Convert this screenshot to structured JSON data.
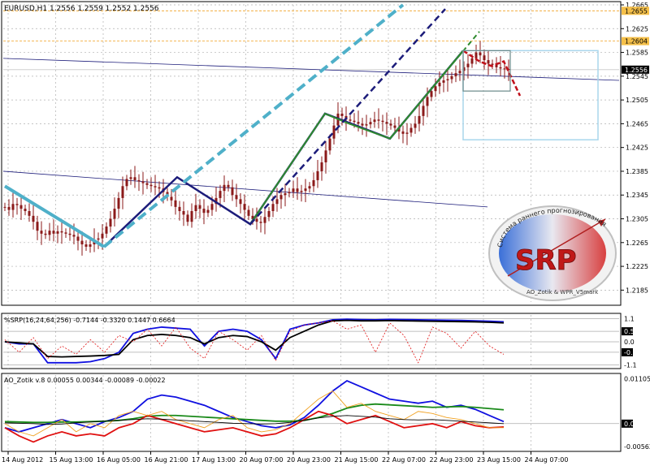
{
  "header": {
    "symbol_line": "EURUSD,H1  1.2556 1.2559 1.2552 1.2556",
    "srp_line": "%SRP(16,24,64,256) -0.7144 -0.3320 0.1447 0.6664",
    "ao_line": "AO_Zotik v.8 0.00055 0.00344 -0.00089 -0.00022"
  },
  "logo": {
    "letters": "SRP",
    "arc_text": "Система раннего прогнозирования",
    "bottom_text": "AO_Zotik & WPR_V5mark"
  },
  "colors": {
    "background": "#ffffff",
    "candles": "#8b1a1a",
    "light_blue_line": "#4fb0c9",
    "navy_line": "#1c1c7a",
    "green_line": "#2e8b2e",
    "red_dashed": "#c0101a",
    "box_light": "#a9d6ec",
    "box_gray": "#6a8a8a",
    "orange_level": "#f0a020",
    "srp_blue": "#1010e0",
    "srp_black": "#000000",
    "ao_blue": "#1010e0",
    "ao_green": "#1a8a1a",
    "ao_red": "#e01010",
    "ao_orange": "#f0a020"
  },
  "chart_data": [
    {
      "type": "candlestick",
      "title": "EURUSD,H1",
      "ylim": [
        1.2165,
        1.2665
      ],
      "y_ticks": [
        "1.2665",
        "1.2625",
        "1.2585",
        "1.2545",
        "1.2505",
        "1.2465",
        "1.2425",
        "1.2385",
        "1.2345",
        "1.2305",
        "1.2265",
        "1.2225",
        "1.2185"
      ],
      "price_tags": [
        {
          "value": "1.2655",
          "color": "#f0a020"
        },
        {
          "value": "1.2604",
          "color": "#f0a020"
        },
        {
          "value": "1.2556",
          "color": "#000000"
        }
      ],
      "x_ticks": [
        "14 Aug 2012",
        "15 Aug 13:00",
        "16 Aug 05:00",
        "16 Aug 21:00",
        "17 Aug 13:00",
        "20 Aug 07:00",
        "20 Aug 23:00",
        "21 Aug 15:00",
        "22 Aug 07:00",
        "22 Aug 23:00",
        "23 Aug 15:00",
        "24 Aug 07:00"
      ],
      "closes": [
        1.2325,
        1.232,
        1.233,
        1.2328,
        1.2322,
        1.2318,
        1.231,
        1.23,
        1.2285,
        1.228,
        1.2278,
        1.2285,
        1.228,
        1.2284,
        1.2282,
        1.228,
        1.2278,
        1.2275,
        1.2268,
        1.2262,
        1.2258,
        1.2262,
        1.227,
        1.2272,
        1.228,
        1.2292,
        1.2305,
        1.2322,
        1.234,
        1.236,
        1.2372,
        1.2375,
        1.237,
        1.2368,
        1.2365,
        1.2362,
        1.236,
        1.2358,
        1.2356,
        1.235,
        1.2342,
        1.2336,
        1.2325,
        1.2318,
        1.2312,
        1.23,
        1.2318,
        1.2328,
        1.2322,
        1.2315,
        1.232,
        1.233,
        1.234,
        1.2352,
        1.2362,
        1.2358,
        1.2345,
        1.2338,
        1.233,
        1.232,
        1.231,
        1.2305,
        1.23,
        1.2298,
        1.2308,
        1.2318,
        1.233,
        1.2338,
        1.2345,
        1.2348,
        1.235,
        1.2356,
        1.235,
        1.2352,
        1.2356,
        1.236,
        1.237,
        1.2385,
        1.24,
        1.242,
        1.244,
        1.2462,
        1.2482,
        1.2478,
        1.2472,
        1.247,
        1.2468,
        1.2465,
        1.2462,
        1.2464,
        1.2468,
        1.2472,
        1.247,
        1.2468,
        1.2465,
        1.2462,
        1.2458,
        1.2452,
        1.2448,
        1.245,
        1.2458,
        1.2465,
        1.2478,
        1.2495,
        1.251,
        1.252,
        1.2528,
        1.2534,
        1.2538,
        1.254,
        1.2545,
        1.255,
        1.2554,
        1.256,
        1.2566,
        1.2575,
        1.2585,
        1.258,
        1.2572,
        1.2566,
        1.2564,
        1.256,
        1.2558,
        1.2557,
        1.2556
      ],
      "mirrored_note": ""
    },
    {
      "type": "line",
      "title": "%SRP(16,24,64,256)",
      "ylim": [
        -1.2,
        1.2
      ],
      "y_ticks": [
        "1.1",
        "0.5",
        "0.0",
        "-0.5",
        "-1.1"
      ],
      "series": [
        {
          "color": "#1010e0",
          "values": [
            0.0,
            -0.1,
            -0.1,
            -1.0,
            -1.0,
            -1.0,
            -0.95,
            -0.8,
            -0.5,
            0.4,
            0.6,
            0.7,
            0.65,
            0.6,
            -0.2,
            0.5,
            0.6,
            0.5,
            0.1,
            -0.8,
            0.6,
            0.8,
            0.9,
            1.05,
            1.08,
            1.06,
            1.05,
            1.07,
            1.06,
            1.05,
            1.04,
            1.03,
            1.02,
            1.0,
            0.98,
            0.95
          ]
        },
        {
          "color": "#000000",
          "values": [
            0.0,
            -0.05,
            -0.1,
            -0.7,
            -0.72,
            -0.7,
            -0.68,
            -0.65,
            -0.6,
            0.1,
            0.3,
            0.35,
            0.3,
            0.2,
            -0.1,
            0.2,
            0.3,
            0.25,
            0.0,
            -0.4,
            0.2,
            0.5,
            0.8,
            1.0,
            1.02,
            1.0,
            1.0,
            1.01,
            1.0,
            0.99,
            0.98,
            0.97,
            0.96,
            0.95,
            0.93,
            0.9
          ]
        },
        {
          "color": "#e01010",
          "dashed": true,
          "values": [
            0.1,
            -0.5,
            0.2,
            -0.8,
            -0.2,
            -0.6,
            0.1,
            -0.5,
            0.3,
            0.0,
            0.6,
            -0.2,
            0.7,
            -0.3,
            -0.8,
            0.5,
            0.1,
            -0.4,
            0.3,
            -0.9,
            0.5,
            0.8,
            0.9,
            1.0,
            0.6,
            0.8,
            -0.5,
            0.9,
            0.3,
            -1.0,
            0.7,
            0.4,
            -0.3,
            0.5,
            -0.2,
            -0.6
          ]
        }
      ]
    },
    {
      "type": "line",
      "title": "AO_Zotik v.8",
      "ylim": [
        -0.006,
        0.0115
      ],
      "y_ticks": [
        "0.01105",
        "0.00",
        "-0.00562"
      ],
      "series": [
        {
          "color": "#1010e0",
          "values": [
            -0.001,
            -0.002,
            -0.001,
            0.0,
            0.001,
            0.0,
            -0.001,
            0.0005,
            0.0015,
            0.003,
            0.006,
            0.007,
            0.0065,
            0.0055,
            0.0045,
            0.003,
            0.0015,
            0.0005,
            -0.0005,
            -0.001,
            -0.0003,
            0.0015,
            0.0045,
            0.008,
            0.0105,
            0.009,
            0.0075,
            0.006,
            0.0055,
            0.005,
            0.0055,
            0.004,
            0.0045,
            0.0035,
            0.002,
            0.0005
          ]
        },
        {
          "color": "#1a8a1a",
          "values": [
            0.0005,
            0.0004,
            0.0003,
            0.0003,
            0.0004,
            0.0004,
            0.0005,
            0.0006,
            0.0008,
            0.0012,
            0.0018,
            0.002,
            0.002,
            0.0018,
            0.0016,
            0.0014,
            0.0012,
            0.001,
            0.0008,
            0.0006,
            0.0006,
            0.0008,
            0.0015,
            0.0025,
            0.0038,
            0.0045,
            0.0048,
            0.0046,
            0.0044,
            0.0042,
            0.004,
            0.0041,
            0.0042,
            0.004,
            0.0037,
            0.0034
          ]
        },
        {
          "color": "#e01010",
          "values": [
            -0.001,
            -0.003,
            -0.0045,
            -0.003,
            -0.002,
            -0.003,
            -0.0025,
            -0.003,
            -0.001,
            0.0,
            0.002,
            0.001,
            0.0,
            -0.001,
            -0.002,
            -0.0015,
            -0.001,
            -0.002,
            -0.003,
            -0.0025,
            -0.001,
            0.001,
            0.003,
            0.002,
            0.0,
            0.001,
            0.002,
            0.0005,
            -0.001,
            -0.0005,
            0.0,
            -0.001,
            0.0005,
            -0.0005,
            -0.001,
            -0.0008
          ]
        },
        {
          "color": "#f0a020",
          "values": [
            0.0,
            -0.002,
            -0.003,
            -0.001,
            0.001,
            -0.002,
            0.0,
            -0.001,
            0.002,
            0.003,
            0.002,
            0.003,
            0.001,
            0.0,
            -0.001,
            0.001,
            0.002,
            -0.001,
            -0.002,
            -0.0015,
            0.0,
            0.003,
            0.006,
            0.008,
            0.004,
            0.005,
            0.003,
            0.002,
            0.001,
            0.003,
            0.0025,
            0.0015,
            0.001,
            0.0,
            -0.001,
            -0.001
          ]
        },
        {
          "color": "#000000",
          "values": [
            0.0002,
            0.0001,
            0.0,
            -0.0002,
            -0.0001,
            0.0002,
            0.0004,
            0.0006,
            0.0008,
            0.001,
            0.0012,
            0.0011,
            0.0009,
            0.0007,
            0.0005,
            0.0003,
            0.0001,
            0.0,
            -0.0001,
            0.0,
            0.0003,
            0.0008,
            0.0014,
            0.0018,
            0.002,
            0.0018,
            0.0016,
            0.0012,
            0.001,
            0.0009,
            0.001,
            0.0008,
            0.0006,
            0.0004,
            0.0002,
            0.0
          ]
        }
      ]
    }
  ]
}
